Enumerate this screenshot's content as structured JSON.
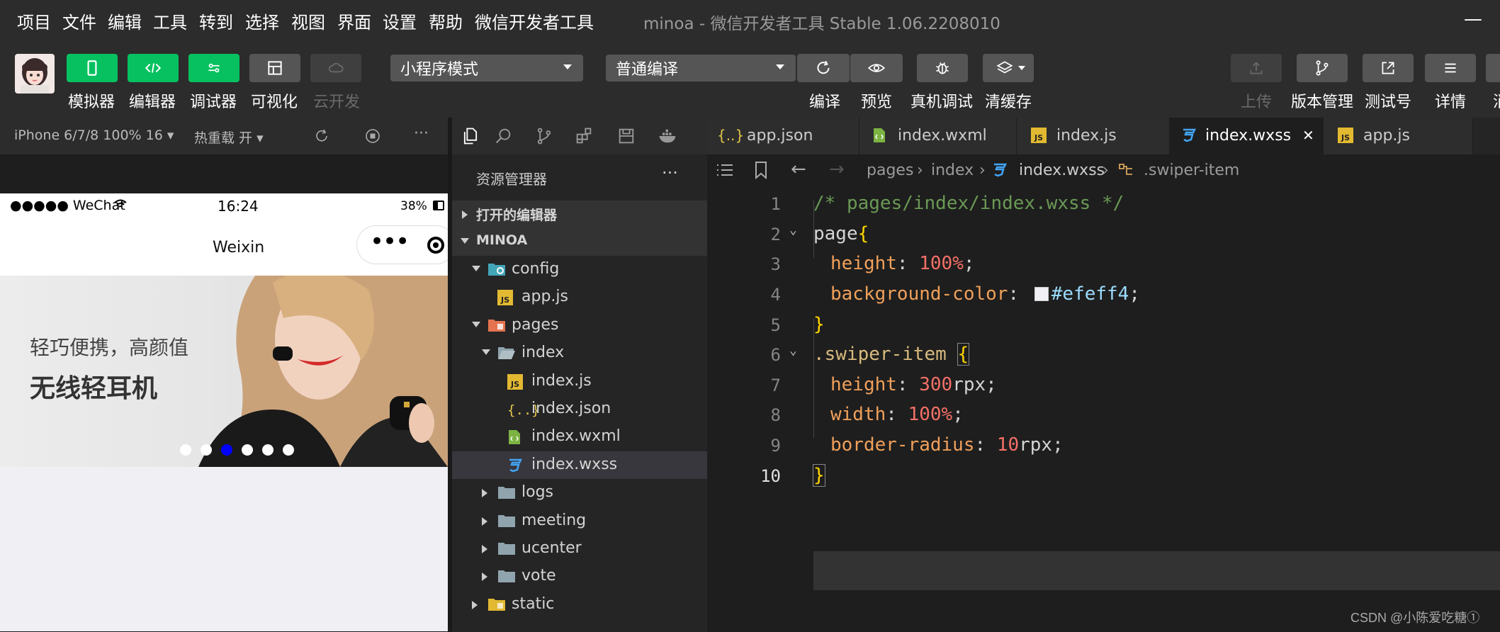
{
  "menu": [
    "项目",
    "文件",
    "编辑",
    "工具",
    "转到",
    "选择",
    "视图",
    "界面",
    "设置",
    "帮助",
    "微信开发者工具"
  ],
  "window_title": "minoa - 微信开发者工具 Stable 1.06.2208010",
  "toolbar": {
    "left_buttons": [
      {
        "label": "模拟器",
        "icon": "phone-icon"
      },
      {
        "label": "编辑器",
        "icon": "code-icon"
      },
      {
        "label": "调试器",
        "icon": "debug-toggle-icon"
      },
      {
        "label": "可视化",
        "icon": "layout-icon"
      },
      {
        "label": "云开发",
        "icon": "cloud-icon"
      }
    ],
    "mode_select": "小程序模式",
    "compile_select": "普通编译",
    "mid_buttons": [
      {
        "label": "编译",
        "icon": "refresh-icon"
      },
      {
        "label": "预览",
        "icon": "eye-icon"
      },
      {
        "label": "真机调试",
        "icon": "bug-icon"
      },
      {
        "label": "清缓存",
        "icon": "layers-icon"
      }
    ],
    "right_buttons": [
      {
        "label": "上传",
        "icon": "upload-icon"
      },
      {
        "label": "版本管理",
        "icon": "branch-icon"
      },
      {
        "label": "测试号",
        "icon": "external-icon"
      },
      {
        "label": "详情",
        "icon": "menu-icon"
      },
      {
        "label": "消",
        "icon": "more-icon"
      }
    ]
  },
  "simulator": {
    "device": "iPhone 6/7/8 100% 16 ▾",
    "hot_reload": "热重载 开 ▾",
    "status": {
      "carrier": "●●●●● WeChat",
      "time": "16:24",
      "battery": "38%"
    },
    "nav_title": "Weixin",
    "capsule_dots": "•••",
    "banner": {
      "line1": "轻巧便携，高颜值",
      "line2": "无线轻耳机"
    },
    "swiper_dots_total": 6,
    "swiper_active_index": 2
  },
  "explorer": {
    "title": "资源管理器",
    "more": "···",
    "sections": [
      "打开的编辑器",
      "MINOA"
    ],
    "tree": [
      {
        "label": "config",
        "depth": 1,
        "arrow": "down",
        "icon": "config-folder-icon"
      },
      {
        "label": "app.js",
        "depth": 2,
        "arrow": "",
        "icon": "js-file-icon"
      },
      {
        "label": "pages",
        "depth": 1,
        "arrow": "down",
        "icon": "pages-folder-icon"
      },
      {
        "label": "index",
        "depth": 2,
        "arrow": "down",
        "icon": "folder-open-icon"
      },
      {
        "label": "index.js",
        "depth": 3,
        "arrow": "",
        "icon": "js-file-icon"
      },
      {
        "label": "index.json",
        "depth": 3,
        "arrow": "",
        "icon": "json-file-icon"
      },
      {
        "label": "index.wxml",
        "depth": 3,
        "arrow": "",
        "icon": "wxml-file-icon"
      },
      {
        "label": "index.wxss",
        "depth": 3,
        "arrow": "",
        "icon": "wxss-file-icon",
        "selected": true
      },
      {
        "label": "logs",
        "depth": 2,
        "arrow": "right",
        "icon": "folder-icon"
      },
      {
        "label": "meeting",
        "depth": 2,
        "arrow": "right",
        "icon": "folder-icon"
      },
      {
        "label": "ucenter",
        "depth": 2,
        "arrow": "right",
        "icon": "folder-icon"
      },
      {
        "label": "vote",
        "depth": 2,
        "arrow": "right",
        "icon": "folder-icon"
      },
      {
        "label": "static",
        "depth": 1,
        "arrow": "right",
        "icon": "static-folder-icon"
      }
    ]
  },
  "editor": {
    "tabs": [
      {
        "label": "app.json",
        "icon": "json-file-icon"
      },
      {
        "label": "index.wxml",
        "icon": "wxml-file-icon"
      },
      {
        "label": "index.js",
        "icon": "js-file-icon"
      },
      {
        "label": "index.wxss",
        "icon": "wxss-file-icon",
        "active": true
      },
      {
        "label": "app.js",
        "icon": "js-file-icon"
      }
    ],
    "close": "✕",
    "breadcrumb": [
      "pages",
      "index",
      "index.wxss",
      ".swiper-item"
    ],
    "line_numbers": [
      "1",
      "2",
      "3",
      "4",
      "5",
      "6",
      "7",
      "8",
      "9",
      "10"
    ],
    "code": {
      "l1": "/* pages/index/index.wxss */",
      "l2_sel": "page",
      "l2_brace": "{",
      "l3_prop": "height",
      "l3_val": "100%",
      "l4_prop": "background-color",
      "l4_val": "#efeff4",
      "l5": "}",
      "l6_sel": ".swiper-item",
      "l6_brace": "{",
      "l7_prop": "height",
      "l7_num": "300",
      "l7_unit": "rpx",
      "l8_prop": "width",
      "l8_val": "100%",
      "l9_prop": "border-radius",
      "l9_num": "10",
      "l9_unit": "rpx",
      "l10": "}"
    },
    "swatch_color": "#efeff4"
  },
  "watermark": "CSDN @小陈爱吃糖①"
}
